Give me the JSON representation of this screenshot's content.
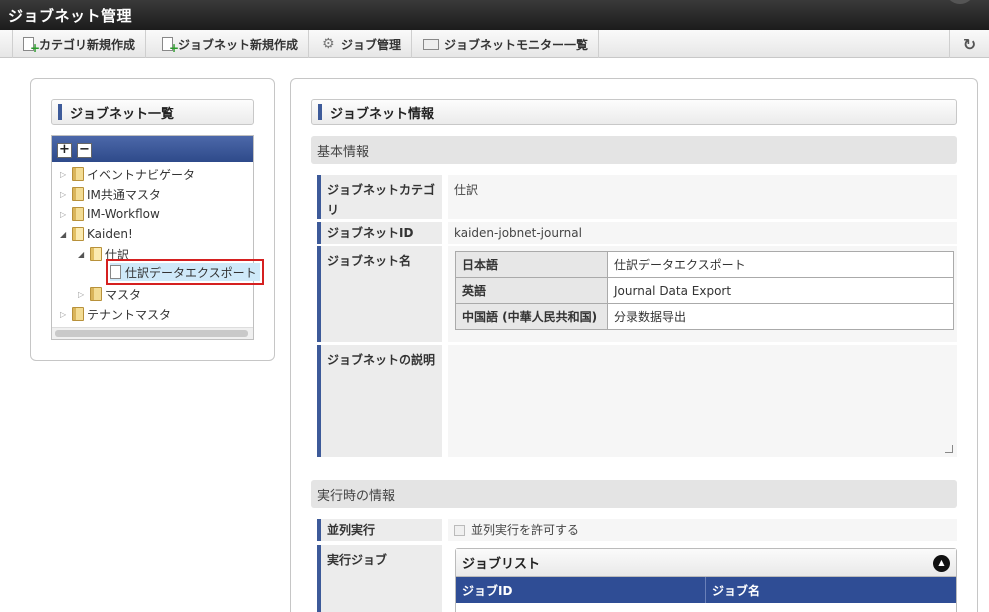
{
  "app": {
    "title": "ジョブネット管理"
  },
  "toolbar": {
    "new_category": "カテゴリ新規作成",
    "new_jobnet": "ジョブネット新規作成",
    "job_manage": "ジョブ管理",
    "jobnet_monitor": "ジョブネットモニター一覧",
    "refresh_icon": "refresh-icon"
  },
  "left": {
    "title": "ジョブネット一覧",
    "tree": [
      {
        "label": "イベントナビゲータ",
        "expanded": false
      },
      {
        "label": "IM共通マスタ",
        "expanded": false
      },
      {
        "label": "IM-Workflow",
        "expanded": false
      },
      {
        "label": "Kaiden!",
        "expanded": true
      },
      {
        "label": "仕訳",
        "expanded": true
      },
      {
        "label": "仕訳データエクスポート",
        "selected": true
      },
      {
        "label": "マスタ",
        "expanded": false
      },
      {
        "label": "テナントマスタ",
        "expanded": false
      }
    ]
  },
  "right": {
    "title": "ジョブネット情報",
    "basic_section": "基本情報",
    "fields": {
      "category_label": "ジョブネットカテゴリ",
      "category_value": "仕訳",
      "id_label": "ジョブネットID",
      "id_value": "kaiden-jobnet-journal",
      "name_label": "ジョブネット名",
      "names": [
        {
          "lang": "日本語",
          "value": "仕訳データエクスポート"
        },
        {
          "lang": "英語",
          "value": "Journal Data Export"
        },
        {
          "lang": "中国語 (中華人民共和国)",
          "value": "分录数据导出"
        }
      ],
      "desc_label": "ジョブネットの説明",
      "desc_value": ""
    },
    "runtime_section": "実行時の情報",
    "parallel_label": "並列実行",
    "parallel_checkbox": "並列実行を許可する",
    "parallel_checked": false,
    "jobs_label": "実行ジョブ",
    "joblist": {
      "title": "ジョブリスト",
      "columns": [
        "ジョブID",
        "ジョブ名"
      ]
    }
  }
}
